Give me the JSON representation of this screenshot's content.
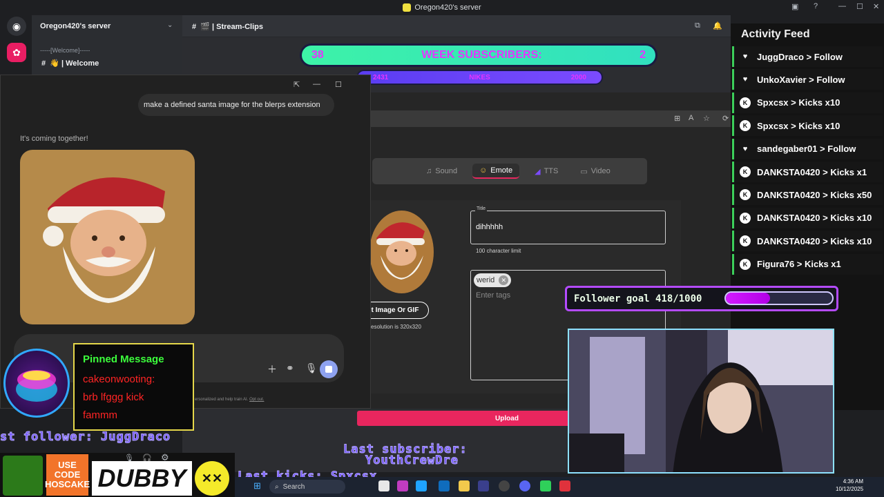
{
  "window": {
    "title": "Oregon420's server"
  },
  "server": {
    "name": "Oregon420's server",
    "category": "-----[Welcome]-----",
    "channel": "👋 | Welcome"
  },
  "header": {
    "channel": "🎬 | Stream-Clips"
  },
  "subscribers": {
    "left_count": "38",
    "label": "WEEK SUBSCRIBERS:",
    "right_count": "2",
    "goal_left": "2431",
    "goal_label": "NIKES",
    "goal_right": "2000"
  },
  "chat": {
    "user_message": "make a defined santa image for the blerps extension",
    "assistant_status": "It's coming together!",
    "disclaimer": "ersonalized and help train AI.",
    "opt_out": "Opt out."
  },
  "blerp": {
    "tabs": [
      {
        "icon": "♫",
        "label": "Sound"
      },
      {
        "icon": "☺",
        "label": "Emote"
      },
      {
        "icon": "◢",
        "label": "TTS"
      },
      {
        "icon": "▭",
        "label": "Video"
      }
    ],
    "title_label": "Title",
    "title_value": "dihhhhh",
    "char_limit": "100 character limit",
    "tag": "werid",
    "tags_placeholder": "Enter tags",
    "select_image": "t Image Or GIF",
    "resolution": "esolution is 320x320",
    "upload": "Upload"
  },
  "follower_goal": {
    "label": "Follower goal 418/1000",
    "progress": 0.418
  },
  "activity_feed": {
    "title": "Activity Feed",
    "items": [
      {
        "type": "heart",
        "text": "JuggDraco > Follow"
      },
      {
        "type": "heart",
        "text": "UnkoXavier > Follow"
      },
      {
        "type": "kick",
        "text": "Spxcsx > Kicks x10"
      },
      {
        "type": "kick",
        "text": "Spxcsx > Kicks x10"
      },
      {
        "type": "heart",
        "text": "sandegaber01 > Follow"
      },
      {
        "type": "kick",
        "text": "DANKSTA0420 > Kicks x1"
      },
      {
        "type": "kick",
        "text": "DANKSTA0420 > Kicks x50"
      },
      {
        "type": "kick",
        "text": "DANKSTA0420 > Kicks x10"
      },
      {
        "type": "kick",
        "text": "DANKSTA0420 > Kicks x10"
      },
      {
        "type": "kick",
        "text": "Figura76 > Kicks x1"
      }
    ]
  },
  "pinned": {
    "heading": "Pinned Message",
    "lines": [
      "cakeonwooting:",
      "brb lfggg kick",
      "fammm"
    ]
  },
  "overlay": {
    "last_follower": "st follower: JuggDraco",
    "last_subscriber_label": "Last subscriber:",
    "last_subscriber": "YouthCrewDre",
    "last_kicks": "Last kicks: Spxcsx"
  },
  "sponsor": {
    "use_code_1": "USE",
    "use_code_2": "CODE",
    "use_code_3": "HOSCAKE",
    "brand": "DUBBY"
  },
  "taskbar": {
    "search": "Search",
    "time": "4:36 AM",
    "date": "10/12/2025"
  },
  "colors": {
    "discord_bg": "#1e1f22",
    "accent_pink": "#e8265e",
    "feed_green": "#3ccf5a",
    "goal_purple": "#b44bff"
  }
}
